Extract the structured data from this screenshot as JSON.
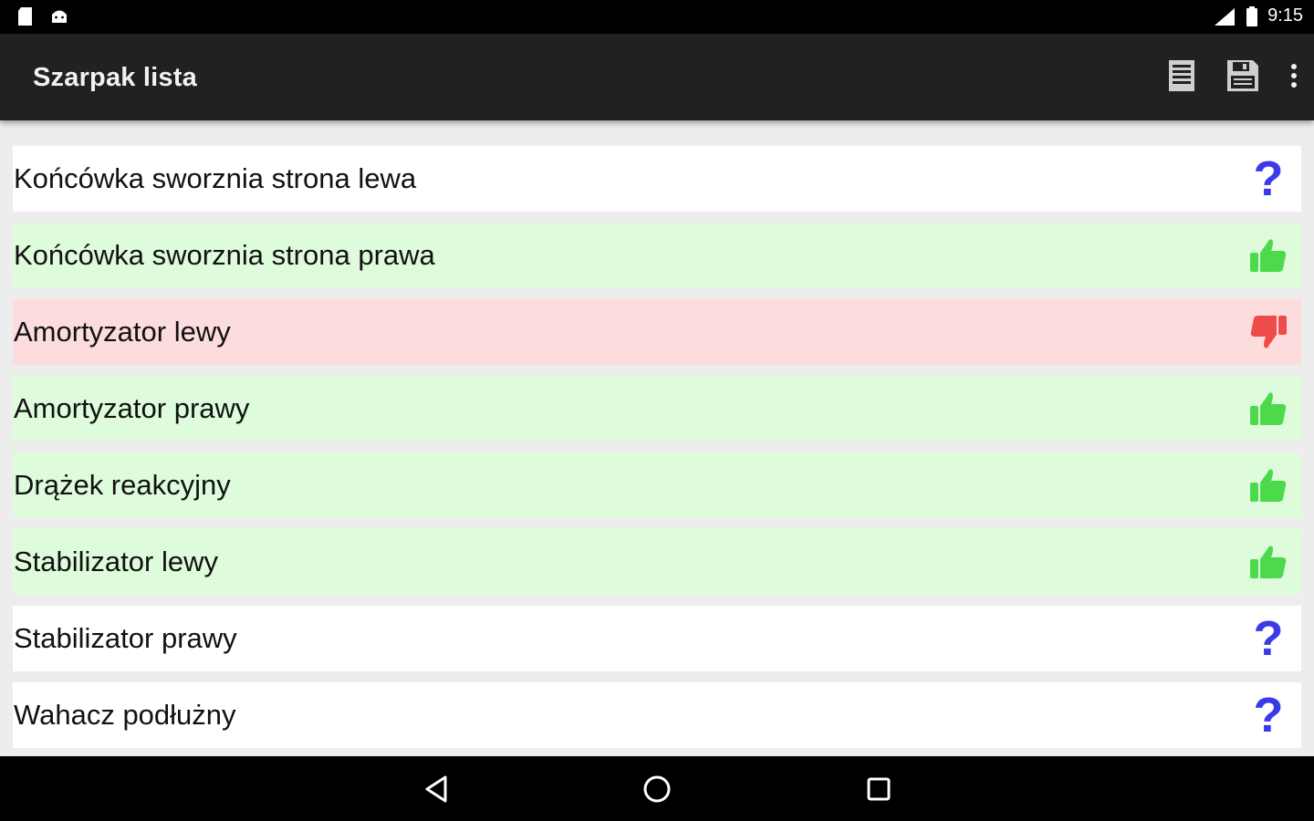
{
  "status": {
    "time": "9:15",
    "left_icons": [
      "sd-card-icon",
      "android-icon"
    ],
    "right_icons": [
      "signal-icon",
      "battery-icon"
    ]
  },
  "app_bar": {
    "title": "Szarpak lista",
    "actions": [
      "list-icon",
      "save-icon",
      "overflow-menu-icon"
    ]
  },
  "colors": {
    "ok_bg": "#defcdc",
    "fail_bg": "#fddcde",
    "unknown_bg": "#ffffff",
    "ok_icon": "#4cd94c",
    "fail_icon": "#ee4b4b",
    "unknown_icon": "#3a3ae8"
  },
  "items": [
    {
      "label": "Końcówka sworznia strona lewa",
      "status": "unknown"
    },
    {
      "label": "Końcówka sworznia strona prawa",
      "status": "ok"
    },
    {
      "label": "Amortyzator lewy",
      "status": "fail"
    },
    {
      "label": "Amortyzator prawy",
      "status": "ok"
    },
    {
      "label": "Drążek reakcyjny",
      "status": "ok"
    },
    {
      "label": "Stabilizator lewy",
      "status": "ok"
    },
    {
      "label": "Stabilizator prawy",
      "status": "unknown"
    },
    {
      "label": "Wahacz podłużny",
      "status": "unknown"
    }
  ],
  "nav": [
    "back-icon",
    "home-icon",
    "recents-icon"
  ]
}
